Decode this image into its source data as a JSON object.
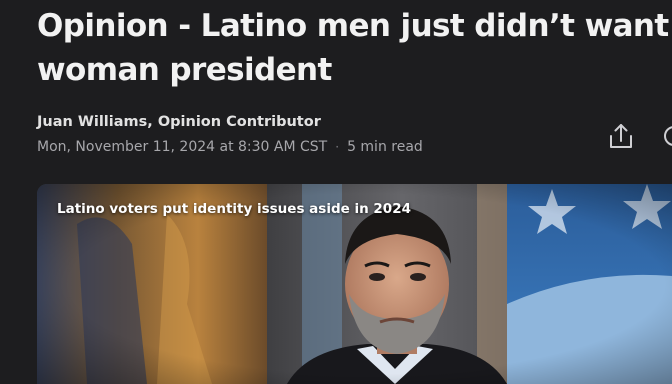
{
  "article": {
    "headline": "Opinion - Latino men just didn’t want a\nwoman president",
    "author_line": "Juan Williams, Opinion Contributor",
    "date": "Mon, November 11, 2024 at 8:30 AM CST",
    "separator": "·",
    "read_time": "5 min read"
  },
  "actions": {
    "share_icon": "share-icon",
    "more_icon": "comment-icon"
  },
  "video": {
    "caption": "Latino voters put identity issues aside in 2024"
  },
  "colors": {
    "background": "#1d1d1f",
    "headline": "#f2f2f2",
    "meta": "#a7a7ab",
    "accent_blue": "#3d7fc4"
  }
}
